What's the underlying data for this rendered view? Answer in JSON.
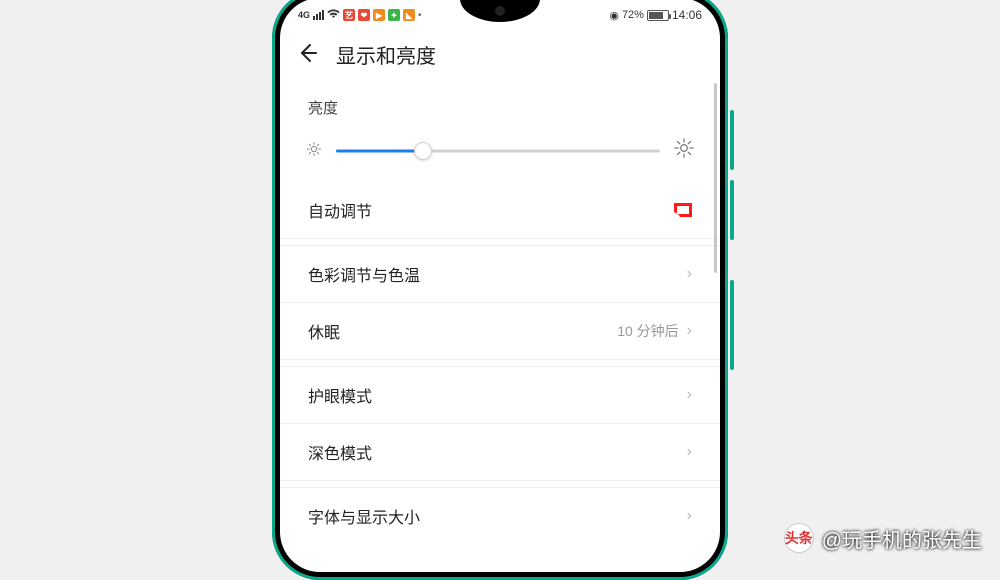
{
  "status": {
    "network": "4G",
    "battery_pct": "72%",
    "time": "14:06"
  },
  "header": {
    "title": "显示和亮度"
  },
  "brightness": {
    "label": "亮度",
    "slider_pct": 27
  },
  "rows": {
    "auto": {
      "label": "自动调节"
    },
    "color": {
      "label": "色彩调节与色温"
    },
    "sleep": {
      "label": "休眠",
      "value": "10 分钟后"
    },
    "eyecare": {
      "label": "护眼模式"
    },
    "dark": {
      "label": "深色模式"
    },
    "font": {
      "label": "字体与显示大小"
    }
  },
  "watermark": {
    "logo_text": "头条",
    "text": "@玩手机的张先生"
  }
}
